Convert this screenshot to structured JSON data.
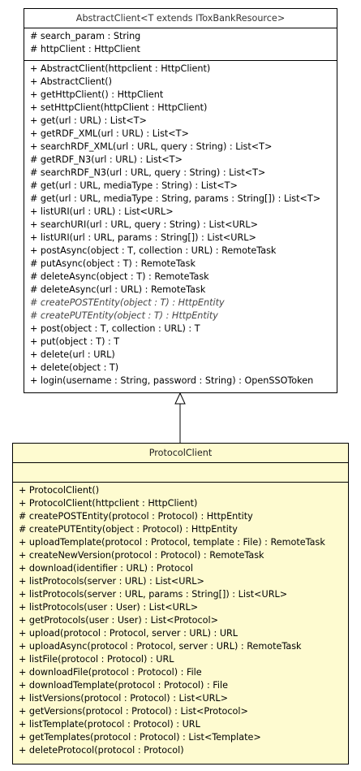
{
  "abstract_client": {
    "name": "AbstractClient<T extends IToxBankResource>",
    "attributes": [
      "# search_param : String",
      "# httpClient : HttpClient"
    ],
    "operations": [
      "+ AbstractClient(httpclient : HttpClient)",
      "+ AbstractClient()",
      "+ getHttpClient() : HttpClient",
      "+ setHttpClient(httpClient : HttpClient)",
      "+ get(url : URL) : List<T>",
      "+ getRDF_XML(url : URL) : List<T>",
      "+ searchRDF_XML(url : URL, query : String) : List<T>",
      "# getRDF_N3(url : URL) : List<T>",
      "# searchRDF_N3(url : URL, query : String) : List<T>",
      "# get(url : URL, mediaType : String) : List<T>",
      "# get(url : URL, mediaType : String, params : String[]) : List<T>",
      "+ listURI(url : URL) : List<URL>",
      "+ searchURI(url : URL, query : String) : List<URL>",
      "+ listURI(url : URL, params : String[]) : List<URL>",
      "+ postAsync(object : T, collection : URL) : RemoteTask",
      "# putAsync(object : T) : RemoteTask",
      "# deleteAsync(object : T) : RemoteTask",
      "# deleteAsync(url : URL) : RemoteTask",
      "# createPOSTEntity(object : T) : HttpEntity",
      "# createPUTEntity(object : T) : HttpEntity",
      "+ post(object : T, collection : URL) : T",
      "+ put(object : T) : T",
      "+ delete(url : URL)",
      "+ delete(object : T)",
      "+ login(username : String, password : String) : OpenSSOToken"
    ],
    "abstract_operations": [
      18,
      19
    ]
  },
  "protocol_client": {
    "name": "ProtocolClient",
    "attributes": [],
    "operations": [
      "+ ProtocolClient()",
      "+ ProtocolClient(httpclient : HttpClient)",
      "# createPOSTEntity(protocol : Protocol) : HttpEntity",
      "# createPUTEntity(object : Protocol) : HttpEntity",
      "+ uploadTemplate(protocol : Protocol, template : File) : RemoteTask",
      "+ createNewVersion(protocol : Protocol) : RemoteTask",
      "+ download(identifier : URL) : Protocol",
      "+ listProtocols(server : URL) : List<URL>",
      "+ listProtocols(server : URL, params : String[]) : List<URL>",
      "+ listProtocols(user : User) : List<URL>",
      "+ getProtocols(user : User) : List<Protocol>",
      "+ upload(protocol : Protocol, server : URL) : URL",
      "+ uploadAsync(protocol : Protocol, server : URL) : RemoteTask",
      "+ listFile(protocol : Protocol) : URL",
      "+ downloadFile(protocol : Protocol) : File",
      "+ downloadTemplate(protocol : Protocol) : File",
      "+ listVersions(protocol : Protocol) : List<URL>",
      "+ getVersions(protocol : Protocol) : List<Protocol>",
      "+ listTemplate(protocol : Protocol) : URL",
      "+ getTemplates(protocol : Protocol) : List<Template>",
      "+ deleteProtocol(protocol : Protocol)"
    ]
  },
  "colors": {
    "abstract_fill": "#ffffff",
    "protocol_fill": "#fefbd0",
    "border": "#000000"
  }
}
